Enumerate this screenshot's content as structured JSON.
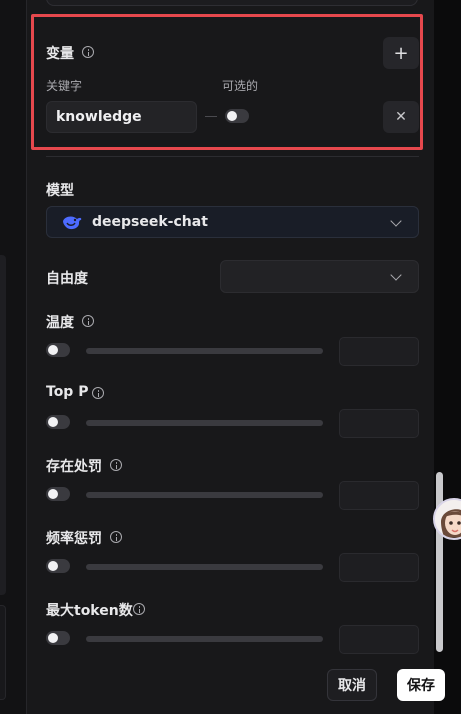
{
  "variables": {
    "title": "变量",
    "keyword_label": "关键字",
    "optional_label": "可选的",
    "keyword_value": "knowledge",
    "add_glyph": "+",
    "remove_glyph": "✕",
    "optional_on": false
  },
  "model": {
    "label": "模型",
    "selected": "deepseek-chat",
    "icon": "deepseek-whale-icon"
  },
  "freedom": {
    "label": "自由度",
    "value": ""
  },
  "params": [
    {
      "label": "温度",
      "enabled": false,
      "value": ""
    },
    {
      "label": "Top P",
      "enabled": false,
      "value": ""
    },
    {
      "label": "存在处罚",
      "enabled": false,
      "value": ""
    },
    {
      "label": "频率惩罚",
      "enabled": false,
      "value": ""
    },
    {
      "label": "最大token数",
      "enabled": false,
      "value": ""
    }
  ],
  "footer": {
    "cancel_label": "取消",
    "save_label": "保存"
  },
  "colors": {
    "highlight": "#e5484d",
    "panel_bg": "#18181a",
    "model_icon": "#4d6bfe"
  }
}
